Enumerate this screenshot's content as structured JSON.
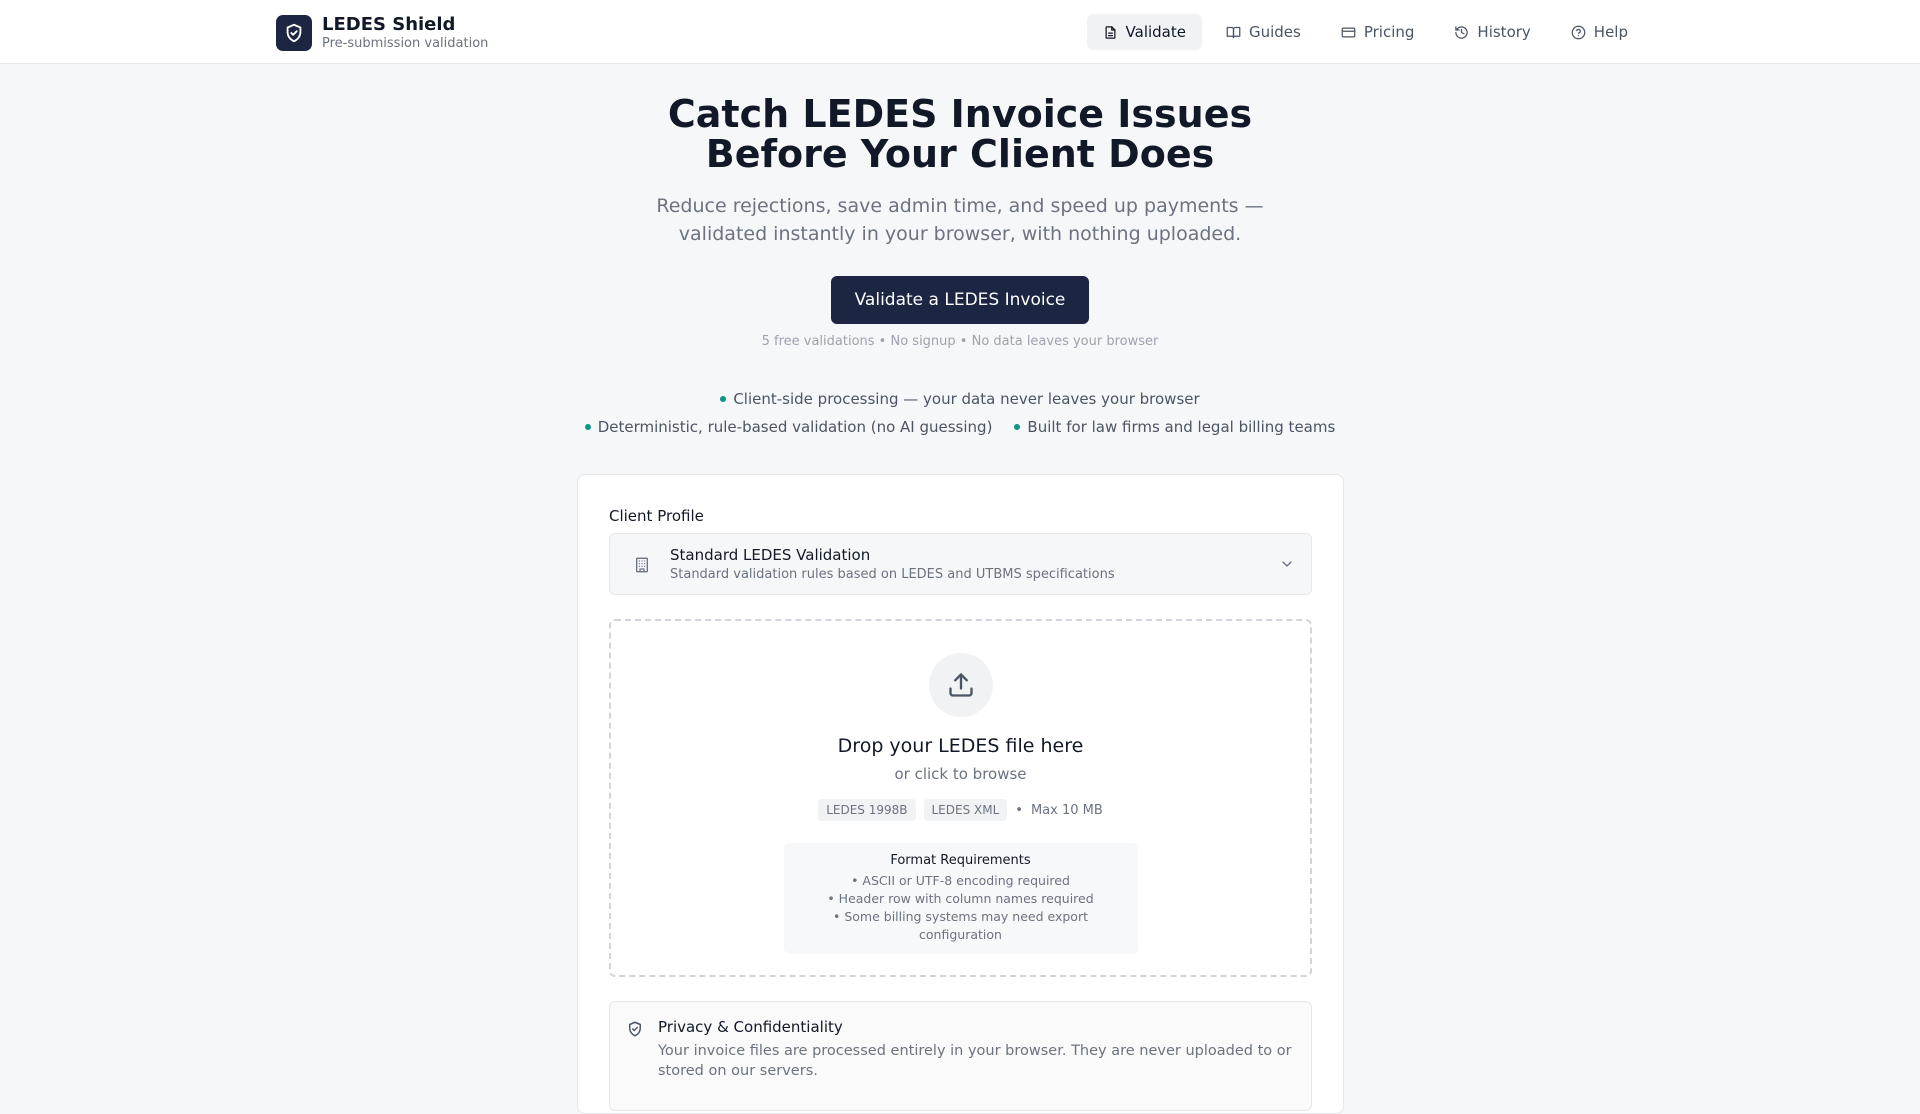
{
  "header": {
    "brand_name": "LEDES Shield",
    "brand_subtitle": "Pre-submission validation",
    "nav": [
      {
        "label": "Validate",
        "icon": "file-icon",
        "active": true
      },
      {
        "label": "Guides",
        "icon": "book-icon",
        "active": false
      },
      {
        "label": "Pricing",
        "icon": "card-icon",
        "active": false
      },
      {
        "label": "History",
        "icon": "history-icon",
        "active": false
      },
      {
        "label": "Help",
        "icon": "help-icon",
        "active": false
      }
    ]
  },
  "hero": {
    "title_line1": "Catch LEDES Invoice Issues",
    "title_line2": "Before Your Client Does",
    "subtitle_line1": "Reduce rejections, save admin time, and speed up payments —",
    "subtitle_line2": "validated instantly in your browser, with nothing uploaded.",
    "cta_label": "Validate a LEDES Invoice",
    "cta_note": "5 free validations • No signup • No data leaves your browser"
  },
  "features": [
    "Client-side processing — your data never leaves your browser",
    "Deterministic, rule-based validation (no AI guessing)",
    "Built for law firms and legal billing teams"
  ],
  "profile": {
    "label": "Client Profile",
    "selected_title": "Standard LEDES Validation",
    "selected_desc": "Standard validation rules based on LEDES and UTBMS specifications"
  },
  "dropzone": {
    "title": "Drop your LEDES file here",
    "subtitle": "or click to browse",
    "formats": [
      "LEDES 1998B",
      "LEDES XML"
    ],
    "separator": "•",
    "max_size": "Max 10 MB",
    "requirements_title": "Format Requirements",
    "requirements": [
      "• ASCII or UTF-8 encoding required",
      "• Header row with column names required",
      "• Some billing systems may need export configuration"
    ]
  },
  "privacy": {
    "title": "Privacy & Confidentiality",
    "text": "Your invoice files are processed entirely in your browser. They are never uploaded to or stored on our servers."
  },
  "colors": {
    "primary": "#1c2541",
    "accent_dot": "#0d9488"
  }
}
